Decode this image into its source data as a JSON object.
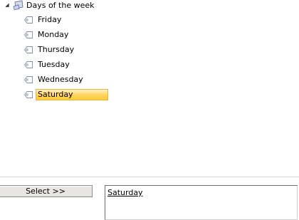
{
  "tree": {
    "root": {
      "label": "Days of the week",
      "icon": "calendar-icon",
      "expander": "expanded"
    },
    "items": [
      {
        "label": "Friday",
        "icon": "tag-icon",
        "selected": false
      },
      {
        "label": "Monday",
        "icon": "tag-icon",
        "selected": false
      },
      {
        "label": "Thursday",
        "icon": "tag-icon",
        "selected": false
      },
      {
        "label": "Tuesday",
        "icon": "tag-icon",
        "selected": false
      },
      {
        "label": "Wednesday",
        "icon": "tag-icon",
        "selected": false
      },
      {
        "label": "Saturday",
        "icon": "tag-icon",
        "selected": true
      }
    ]
  },
  "controls": {
    "select_label": "Select >>",
    "result_value": "Saturday"
  },
  "colors": {
    "selection_fill": "#ffd35c",
    "selection_border": "#e8b33f",
    "button_face": "#e8e6e2"
  }
}
